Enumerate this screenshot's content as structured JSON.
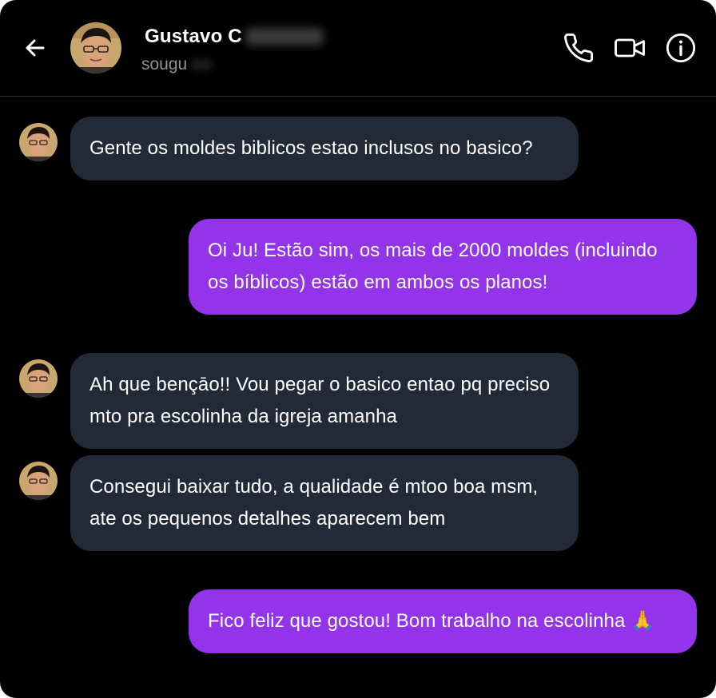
{
  "header": {
    "back_icon": "arrow-left-icon",
    "contact_name": "Gustavo C",
    "contact_handle": "sougu",
    "actions": [
      {
        "name": "phone-call-button",
        "icon": "phone-icon"
      },
      {
        "name": "video-call-button",
        "icon": "video-camera-icon"
      },
      {
        "name": "info-button",
        "icon": "info-icon"
      }
    ]
  },
  "messages": [
    {
      "direction": "in",
      "text": "Gente os moldes biblicos estao inclusos no basico?"
    },
    {
      "direction": "out",
      "text": "Oi Ju! Estão sim, os mais de 2000 moldes (incluindo os bíblicos) estão em ambos os planos!"
    },
    {
      "direction": "in",
      "text": "Ah que bençāo!! Vou pegar o basico entao pq preciso mto pra escolinha da igreja amanha"
    },
    {
      "direction": "in",
      "text": "Consegui baixar tudo, a qualidade é mtoo boa msm, ate os pequenos detalhes aparecem bem"
    },
    {
      "direction": "out",
      "text": "Fico feliz que gostou! Bom trabalho na escolinha 🙏"
    }
  ],
  "colors": {
    "background": "#000000",
    "incoming_bubble": "#222a38",
    "outgoing_bubble": "#9333ea",
    "text": "#ffffff",
    "handle_text": "#8e949d"
  }
}
